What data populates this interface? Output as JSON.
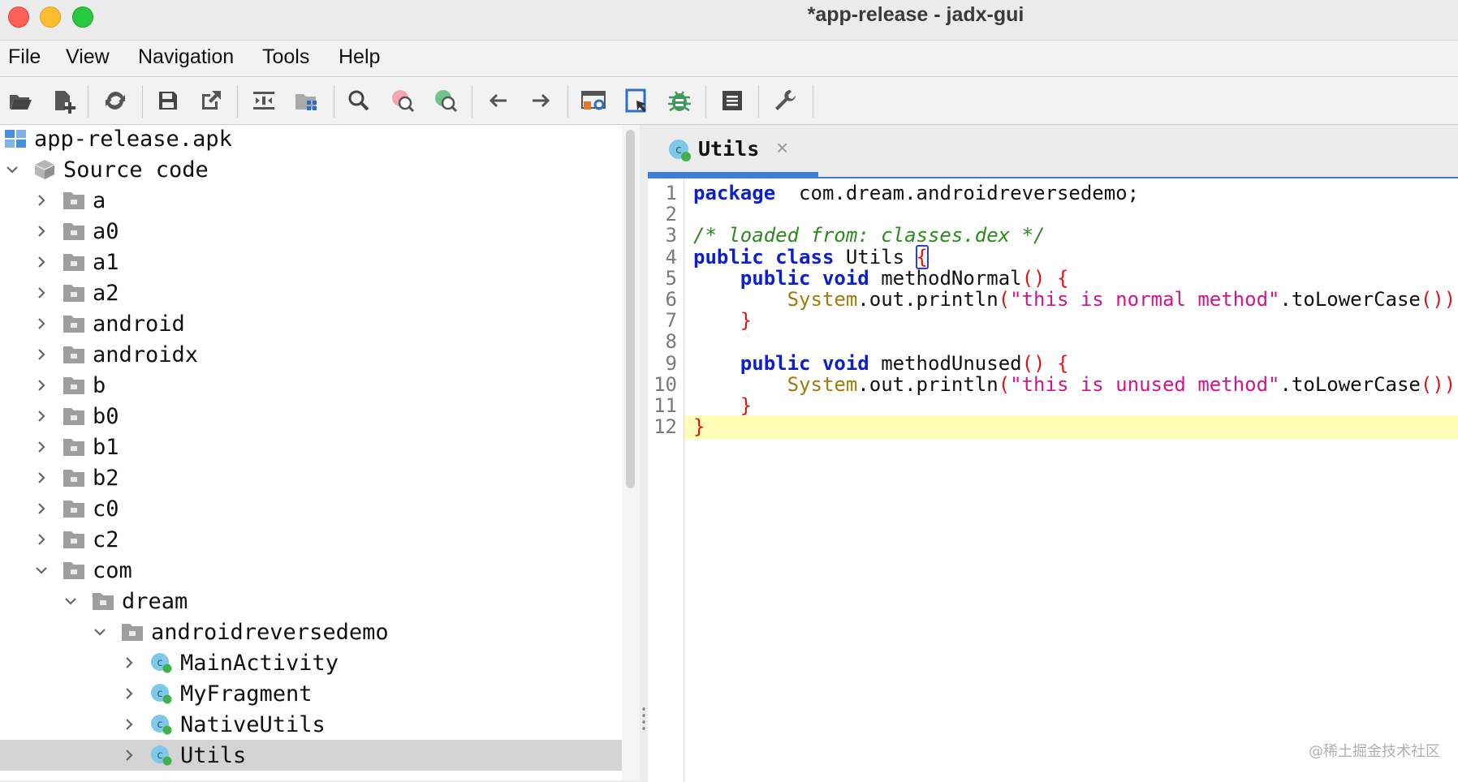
{
  "window": {
    "title": "*app-release - jadx-gui"
  },
  "menu": [
    "File",
    "View",
    "Navigation",
    "Tools",
    "Help"
  ],
  "toolbar_icons": [
    "open-file-icon",
    "add-files-icon",
    "sync-icon",
    "save-all-icon",
    "export-icon",
    "sync-with-editor-icon",
    "flatten-packages-icon",
    "search-text-icon",
    "find-class-icon",
    "find-usage-icon",
    "back-icon",
    "forward-icon",
    "deobfuscation-icon",
    "quark-icon",
    "debugger-icon",
    "log-viewer-icon",
    "preferences-icon"
  ],
  "tree": [
    {
      "label": "app-release.apk",
      "icon": "apk-icon",
      "depth": 0,
      "chevron": "none"
    },
    {
      "label": "Source code",
      "icon": "package-cube-icon",
      "depth": 0,
      "chevron": "down"
    },
    {
      "label": "a",
      "icon": "folder-icon",
      "depth": 1,
      "chevron": "right"
    },
    {
      "label": "a0",
      "icon": "folder-icon",
      "depth": 1,
      "chevron": "right"
    },
    {
      "label": "a1",
      "icon": "folder-icon",
      "depth": 1,
      "chevron": "right"
    },
    {
      "label": "a2",
      "icon": "folder-icon",
      "depth": 1,
      "chevron": "right"
    },
    {
      "label": "android",
      "icon": "folder-icon",
      "depth": 1,
      "chevron": "right"
    },
    {
      "label": "androidx",
      "icon": "folder-icon",
      "depth": 1,
      "chevron": "right"
    },
    {
      "label": "b",
      "icon": "folder-icon",
      "depth": 1,
      "chevron": "right"
    },
    {
      "label": "b0",
      "icon": "folder-icon",
      "depth": 1,
      "chevron": "right"
    },
    {
      "label": "b1",
      "icon": "folder-icon",
      "depth": 1,
      "chevron": "right"
    },
    {
      "label": "b2",
      "icon": "folder-icon",
      "depth": 1,
      "chevron": "right"
    },
    {
      "label": "c0",
      "icon": "folder-icon",
      "depth": 1,
      "chevron": "right"
    },
    {
      "label": "c2",
      "icon": "folder-icon",
      "depth": 1,
      "chevron": "right"
    },
    {
      "label": "com",
      "icon": "folder-icon",
      "depth": 1,
      "chevron": "down"
    },
    {
      "label": "dream",
      "icon": "folder-icon",
      "depth": 2,
      "chevron": "down"
    },
    {
      "label": "androidreversedemo",
      "icon": "folder-icon",
      "depth": 3,
      "chevron": "down"
    },
    {
      "label": "MainActivity",
      "icon": "class-icon",
      "depth": 4,
      "chevron": "right"
    },
    {
      "label": "MyFragment",
      "icon": "class-icon",
      "depth": 4,
      "chevron": "right"
    },
    {
      "label": "NativeUtils",
      "icon": "class-icon",
      "depth": 4,
      "chevron": "right"
    },
    {
      "label": "Utils",
      "icon": "class-icon",
      "depth": 4,
      "chevron": "right",
      "selected": true
    }
  ],
  "editor": {
    "tab": {
      "label": "Utils",
      "close": "×"
    },
    "lines": [
      [
        [
          "kw",
          "package"
        ],
        [
          "",
          "  com.dream.androidreversedemo;"
        ]
      ],
      [],
      [
        [
          "cm",
          "/* loaded from: classes.dex */"
        ]
      ],
      [
        [
          "kw",
          "public class"
        ],
        [
          "",
          " Utils "
        ],
        [
          "br caret",
          "{"
        ]
      ],
      [
        [
          "",
          "    "
        ],
        [
          "kw",
          "public void"
        ],
        [
          "",
          " methodNormal"
        ],
        [
          "br",
          "()"
        ],
        [
          "",
          " "
        ],
        [
          "br",
          "{"
        ]
      ],
      [
        [
          "",
          "        "
        ],
        [
          "fd",
          "System"
        ],
        [
          "",
          ".out.println"
        ],
        [
          "br",
          "("
        ],
        [
          "st",
          "\"this is normal method\""
        ],
        [
          "",
          ".toLowerCase"
        ],
        [
          "br",
          "())"
        ],
        [
          "",
          ";"
        ]
      ],
      [
        [
          "",
          "    "
        ],
        [
          "br",
          "}"
        ]
      ],
      [],
      [
        [
          "",
          "    "
        ],
        [
          "kw",
          "public void"
        ],
        [
          "",
          " methodUnused"
        ],
        [
          "br",
          "()"
        ],
        [
          "",
          " "
        ],
        [
          "br",
          "{"
        ]
      ],
      [
        [
          "",
          "        "
        ],
        [
          "fd",
          "System"
        ],
        [
          "",
          ".out.println"
        ],
        [
          "br",
          "("
        ],
        [
          "st",
          "\"this is unused method\""
        ],
        [
          "",
          ".toLowerCase"
        ],
        [
          "br",
          "())"
        ],
        [
          "",
          ";"
        ]
      ],
      [
        [
          "",
          "    "
        ],
        [
          "br",
          "}"
        ]
      ],
      [
        [
          "br",
          "}"
        ]
      ]
    ],
    "highlighted_line": 12
  },
  "watermark": "@稀土掘金技术社区"
}
